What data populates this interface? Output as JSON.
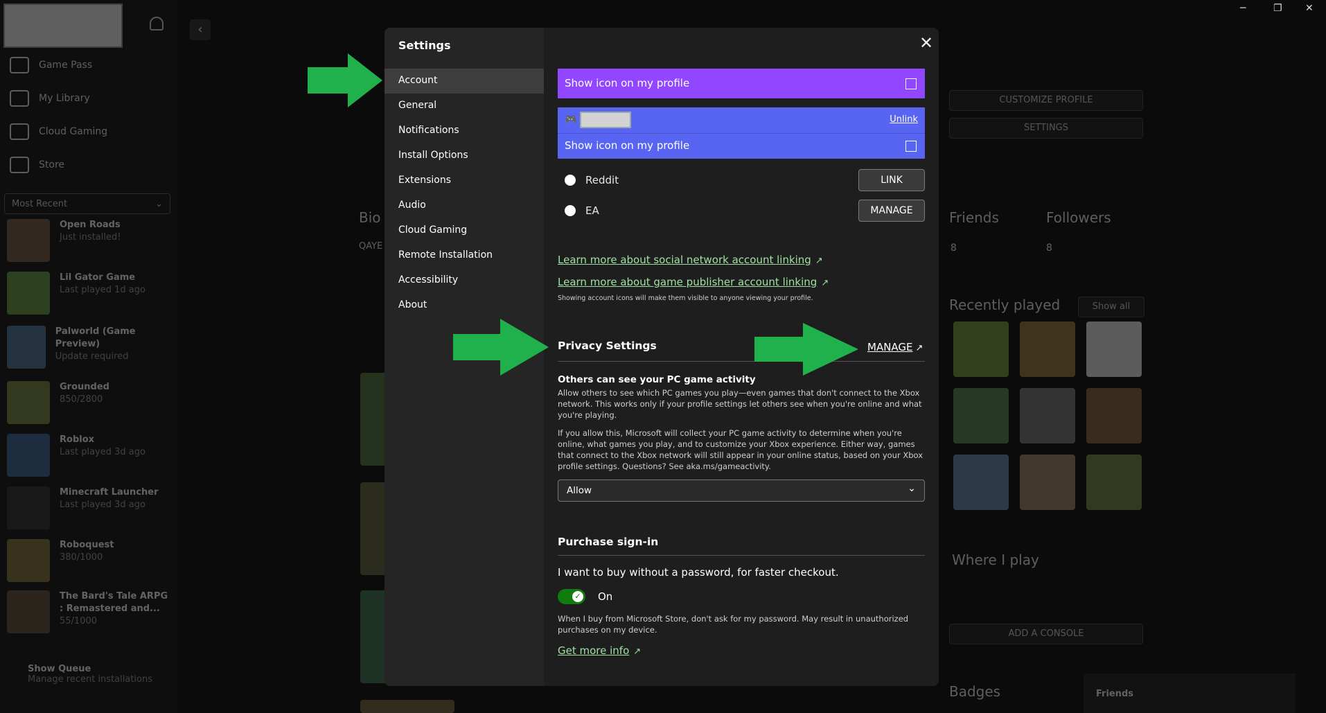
{
  "sidebar": {
    "nav": [
      {
        "label": "Game Pass",
        "icon": "home-icon"
      },
      {
        "label": "My Library",
        "icon": "library-icon"
      },
      {
        "label": "Cloud Gaming",
        "icon": "cloud-icon"
      },
      {
        "label": "Store",
        "icon": "store-icon"
      }
    ],
    "sort_label": "Most Recent",
    "games": [
      {
        "title": "Open Roads",
        "sub": "Just installed!",
        "color": "#6b5440"
      },
      {
        "title": "Lil Gator Game",
        "sub": "Last played 1d ago",
        "color": "#5c8a3c"
      },
      {
        "title": "Palworld (Game Preview)",
        "sub": "Update required",
        "color": "#4a6a8a"
      },
      {
        "title": "Grounded",
        "sub": "850/2800",
        "color": "#6a7a3a"
      },
      {
        "title": "Roblox",
        "sub": "Last played 3d ago",
        "color": "#3a5a8a"
      },
      {
        "title": "Minecraft Launcher",
        "sub": "Last played 3d ago",
        "color": "#2d2d2d"
      },
      {
        "title": "Roboquest",
        "sub": "380/1000",
        "color": "#7a6a3a"
      },
      {
        "title": "The Bard's Tale ARPG : Remastered and...",
        "sub": "55/1000",
        "color": "#5a4a3a"
      }
    ],
    "queue_title": "Show Queue",
    "queue_sub": "Manage recent installations"
  },
  "profile_bg": {
    "bio_label": "Bio",
    "bio_text": "QAYE",
    "customize": "CUSTOMIZE PROFILE",
    "settings": "SETTINGS",
    "friends": "Friends",
    "followers": "Followers",
    "friends_count": "8",
    "followers_count": "8",
    "recently_played": "Recently played",
    "show_all": "Show all",
    "where_i_play": "Where I play",
    "add_console": "ADD A CONSOLE",
    "badges": "Badges",
    "friends_panel": "Friends",
    "tile_colors": [
      "#6a8a3a",
      "#8a6a3a",
      "#cccccc",
      "#4a7a4a",
      "#6a6a6a",
      "#7a5a3a",
      "#5a7a9a",
      "#8a7a5a",
      "#6a7a3a"
    ]
  },
  "settings": {
    "title": "Settings",
    "menu": [
      "Account",
      "General",
      "Notifications",
      "Install Options",
      "Extensions",
      "Audio",
      "Cloud Gaming",
      "Remote Installation",
      "Accessibility",
      "About"
    ],
    "active": "Account",
    "twitch_show_icon": "Show icon on my profile",
    "discord_unlink": "Unlink",
    "discord_show_icon": "Show icon on my profile",
    "reddit": {
      "label": "Reddit",
      "button": "LINK"
    },
    "ea": {
      "label": "EA",
      "button": "MANAGE"
    },
    "learn_social": "Learn more about social network account linking",
    "learn_publisher": "Learn more about game publisher account linking",
    "icons_note": "Showing account icons will make them visible to anyone viewing your profile.",
    "privacy_title": "Privacy Settings",
    "privacy_manage": "MANAGE",
    "activity_title": "Others can see your PC game activity",
    "activity_desc": "Allow others to see which PC games you play—even games that don't connect to the Xbox network. This works only if your profile settings let others see when you're online and what you're playing.",
    "activity_desc2": "If you allow this, Microsoft will collect your PC game activity to determine when you're online, what games you play, and to customize your Xbox experience. Either way, games that connect to the Xbox network will still appear in your online status, based on your Xbox profile settings. Questions? See aka.ms/gameactivity.",
    "activity_value": "Allow",
    "purchase_title": "Purchase sign-in",
    "purchase_question": "I want to buy without a password, for faster checkout.",
    "toggle_label": "On",
    "purchase_note": "When I buy from Microsoft Store, don't ask for my password. May result in unauthorized purchases on my device.",
    "get_more_info": "Get more info",
    "colors": {
      "twitch": "#9146ff",
      "discord": "#5865f2",
      "toggle": "#107c10",
      "arrow": "#21b14c"
    }
  },
  "window_controls": {
    "minimize": "─",
    "restore": "❐",
    "close": "✕"
  }
}
